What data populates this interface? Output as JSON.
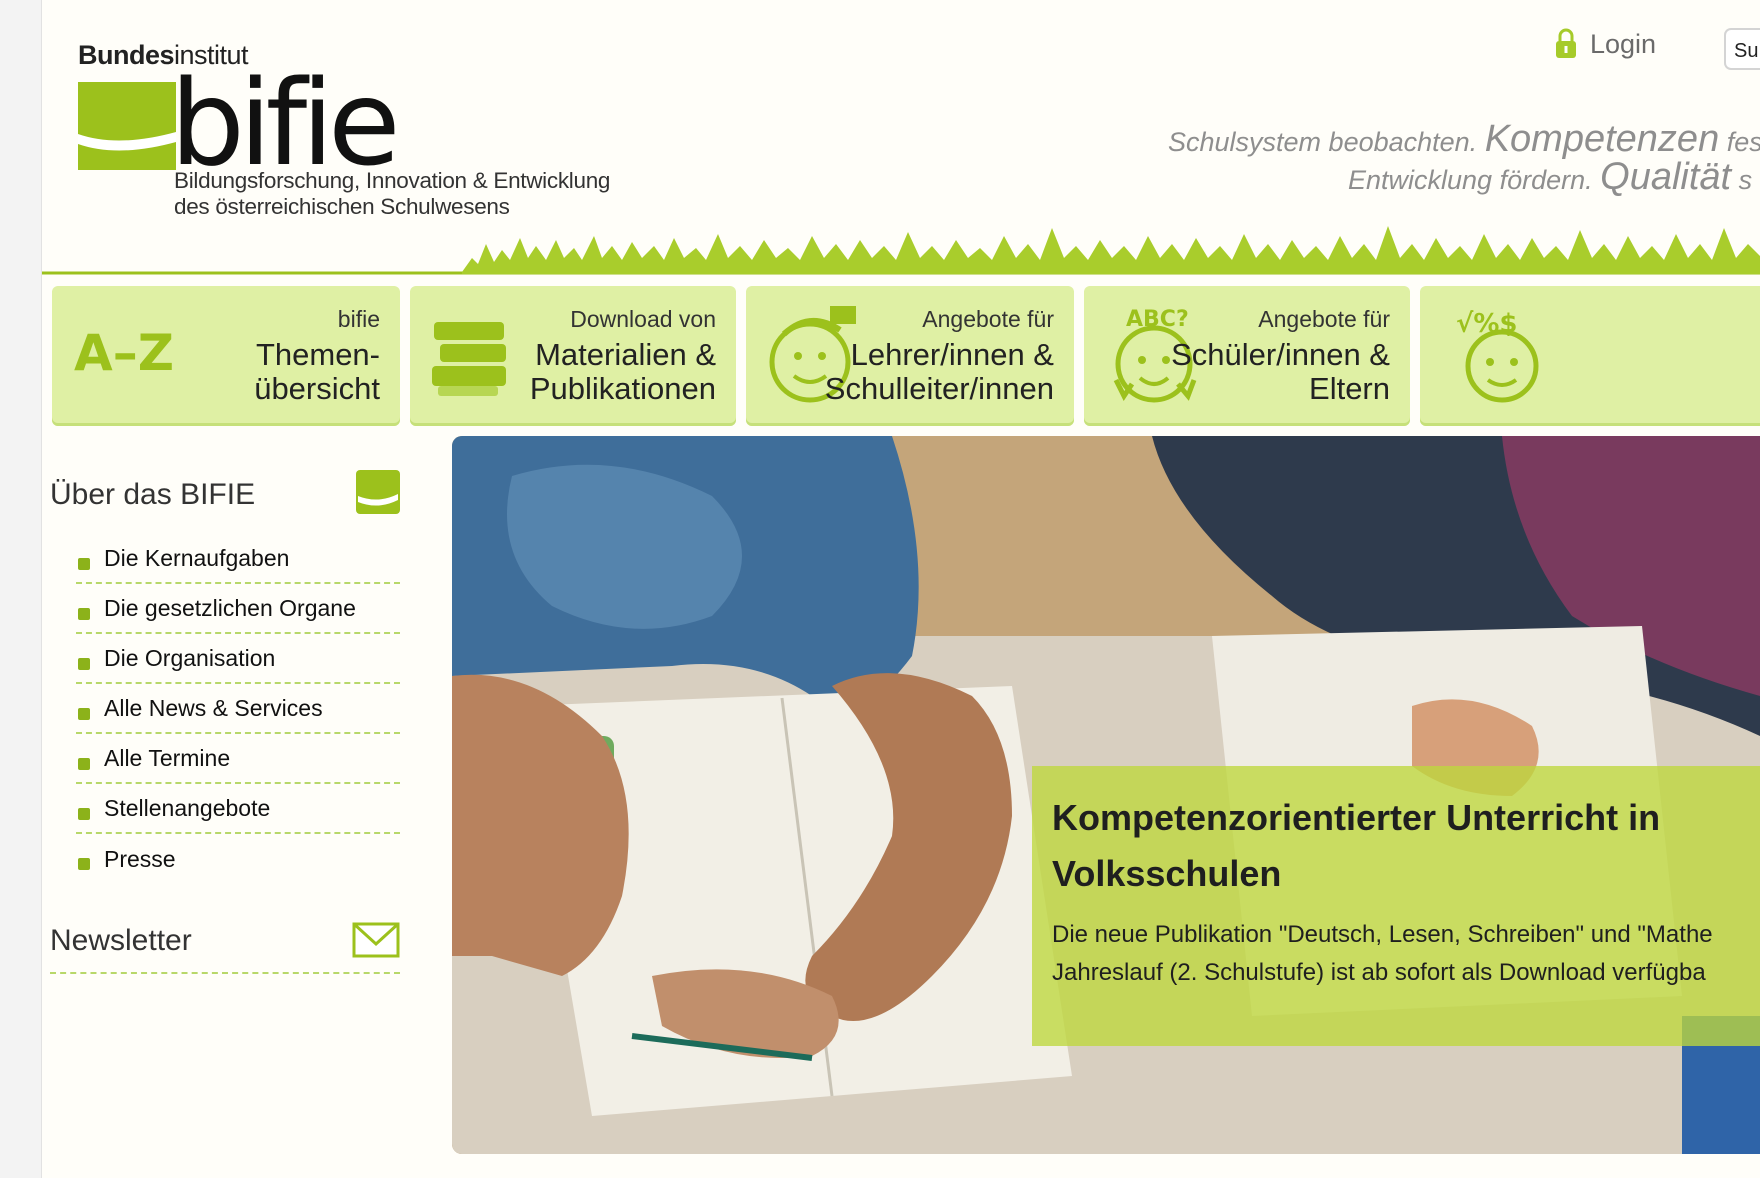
{
  "header": {
    "logo_top_bold": "Bundes",
    "logo_top_rest": "institut",
    "logo_word": "bifie",
    "logo_sub_1": "Bildungsforschung, Innovation & Entwicklung",
    "logo_sub_2": "des österreichischen Schulwesens",
    "login_label": "Login",
    "search_value": "Su",
    "slogan_1a": "Schulsystem beobachten.",
    "slogan_1b": "Kompetenzen",
    "slogan_1c": "feststel",
    "slogan_2a": "Entwicklung fördern.",
    "slogan_2b": "Qualität",
    "slogan_2c": "s"
  },
  "tiles": [
    {
      "small": "bifie",
      "big": "Themen-\nübersicht",
      "icon": "a-z-icon"
    },
    {
      "small": "Download von",
      "big": "Materialien &\nPublikationen",
      "icon": "books-icon"
    },
    {
      "small": "Angebote für",
      "big": "Lehrer/innen &\nSchulleiter/innen",
      "icon": "teacher-face-icon"
    },
    {
      "small": "Angebote für",
      "big": "Schüler/innen &\nEltern",
      "icon": "student-face-icon"
    },
    {
      "small": "",
      "big": "",
      "icon": "math-face-icon"
    }
  ],
  "sidebar": {
    "heading": "Über das BIFIE",
    "items": [
      {
        "label": "Die Kernaufgaben"
      },
      {
        "label": "Die gesetzlichen Organe"
      },
      {
        "label": "Die Organisation"
      },
      {
        "label": "Alle News & Services"
      },
      {
        "label": "Alle Termine"
      },
      {
        "label": "Stellenangebote"
      },
      {
        "label": "Presse"
      }
    ],
    "newsletter": "Newsletter"
  },
  "hero": {
    "title": "Kompetenzorientierter Unterricht in\nVolksschulen",
    "text": "Die neue Publikation \"Deutsch, Lesen, Schreiben\" und \"Mathe\nJahreslauf (2. Schulstufe) ist ab sofort als Download verfügba"
  },
  "colors": {
    "brand_green": "#9cc11c",
    "tile_bg": "#dff0a4",
    "caption_bg": "#bed73c"
  }
}
